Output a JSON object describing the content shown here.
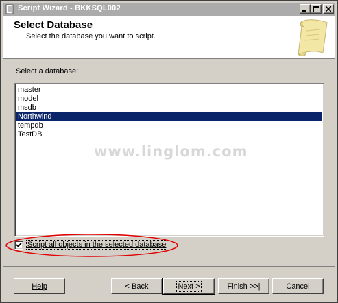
{
  "window": {
    "title": "Script Wizard - BKKSQL002"
  },
  "header": {
    "title": "Select Database",
    "subtitle": "Select the database you want to script."
  },
  "database_list": {
    "label": "Select a database:",
    "items": [
      "master",
      "model",
      "msdb",
      "Northwind",
      "tempdb",
      "TestDB"
    ],
    "selected": "Northwind"
  },
  "watermark": "www.linglom.com",
  "script_all_checkbox": {
    "label": "Script all objects in the selected database",
    "checked": true
  },
  "buttons": {
    "help": "Help",
    "back": "< Back",
    "next": "Next >",
    "finish": "Finish >>|",
    "cancel": "Cancel"
  },
  "colors": {
    "selection": "#0a246a",
    "highlight_ellipse": "#e00000",
    "face": "#d4d0c8"
  }
}
